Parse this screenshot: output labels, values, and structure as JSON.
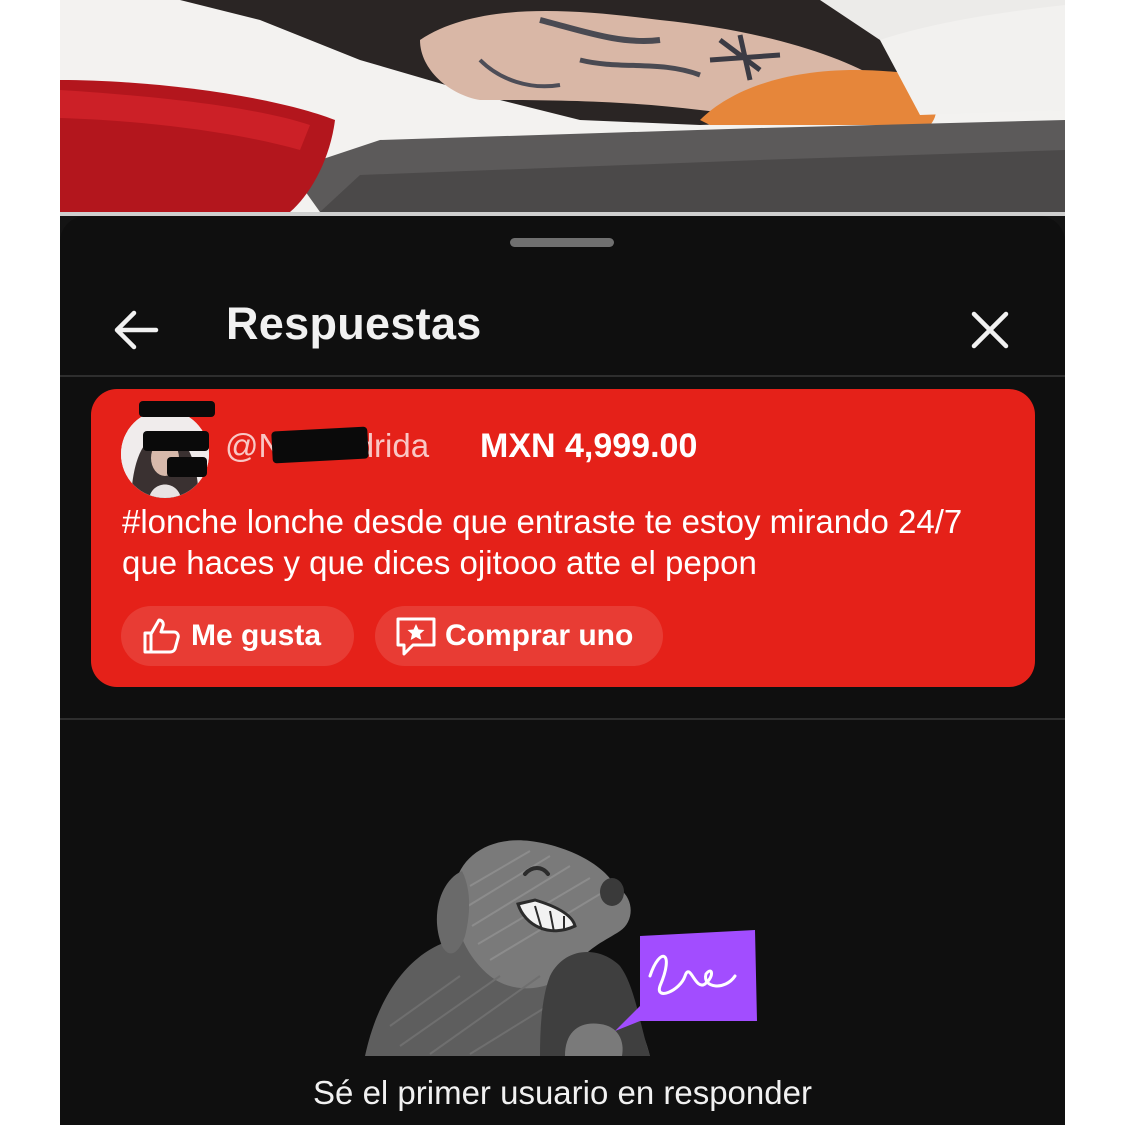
{
  "sheet": {
    "title": "Respuestas",
    "back_icon": "arrow-left-icon",
    "close_icon": "close-icon"
  },
  "super_chat": {
    "username": "@Natmadrida",
    "amount": "MXN 4,999.00",
    "message": "#lonche lonche desde que entraste te estoy mirando 24/7 que haces y que dices ojitooo atte el pepon",
    "like_label": "Me gusta",
    "buy_label": "Comprar uno",
    "card_color": "#e52119"
  },
  "empty_state": {
    "text": "Sé el primer usuario en responder",
    "text_line2": "·· · ···· · · ·· ·· · ·"
  }
}
